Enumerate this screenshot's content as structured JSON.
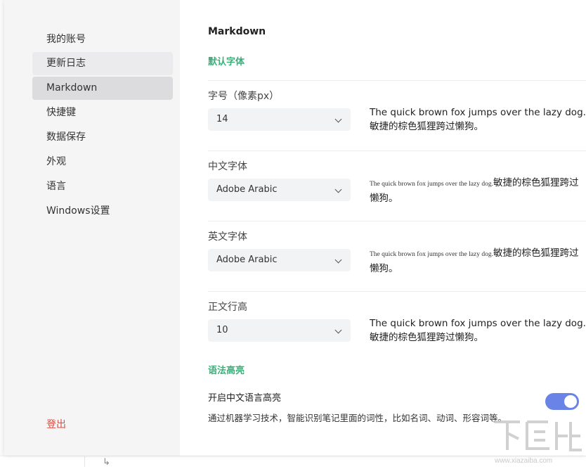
{
  "nav": {
    "items": [
      {
        "label": "我的账号"
      },
      {
        "label": "更新日志"
      },
      {
        "label": "Markdown"
      },
      {
        "label": "快捷键"
      },
      {
        "label": "数据保存"
      },
      {
        "label": "外观"
      },
      {
        "label": "语言"
      },
      {
        "label": "Windows设置"
      }
    ],
    "logout": "登出"
  },
  "content": {
    "title": "Markdown",
    "font_section": "默认字体",
    "font_size": {
      "label": "字号（像素px）",
      "value": "14",
      "preview": "The quick brown fox jumps over the lazy dog.敏捷的棕色狐狸跨过懒狗。"
    },
    "cn_font": {
      "label": "中文字体",
      "value": "Adobe Arabic",
      "preview_en": "The quick brown fox jumps over the lazy dog.",
      "preview_cn": "敏捷的棕色狐狸跨过懒狗。"
    },
    "en_font": {
      "label": "英文字体",
      "value": "Adobe Arabic",
      "preview_en": "The quick brown fox jumps over the lazy dog.",
      "preview_cn": "敏捷的棕色狐狸跨过懒狗。"
    },
    "line_height": {
      "label": "正文行高",
      "value": "10",
      "preview": "The quick brown fox jumps over the lazy dog.敏捷的棕色狐狸跨过懒狗。"
    },
    "syntax_section": "语法高亮",
    "cn_highlight": {
      "label": "开启中文语言高亮",
      "description": "通过机器学习技术，智能识别笔记里面的词性，比如名词、动词、形容词等。",
      "enabled": true
    }
  },
  "colors": {
    "accent_green": "#3dad7b",
    "toggle_on": "#6a83e6",
    "logout_red": "#e04b3f"
  }
}
